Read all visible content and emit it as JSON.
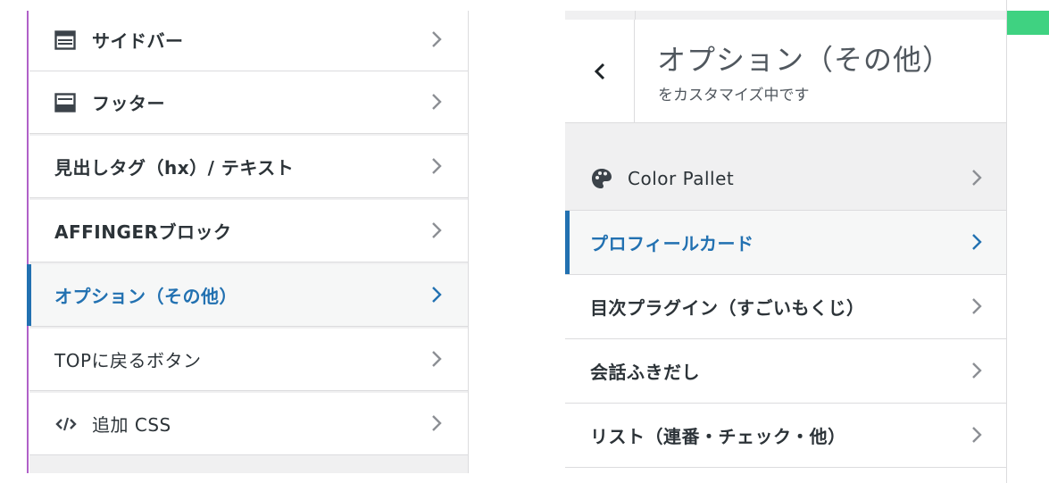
{
  "left_panel": {
    "items": [
      {
        "label": "サイドバー",
        "icon": "layout-icon"
      },
      {
        "label": "フッター",
        "icon": "layout-icon"
      },
      {
        "label": "見出しタグ（hx）/ テキスト"
      },
      {
        "label": "AFFINGERブロック"
      },
      {
        "label": "オプション（その他）",
        "active": true
      },
      {
        "label": "TOPに戻るボタン"
      },
      {
        "label": "追加 CSS",
        "icon": "code-icon"
      }
    ]
  },
  "right_panel": {
    "title": "オプション（その他）",
    "subtitle": "をカスタマイズ中です",
    "items": [
      {
        "label": "Color Pallet",
        "icon": "palette-icon"
      },
      {
        "label": "プロフィールカード",
        "active": true
      },
      {
        "label": "目次プラグイン（すごいもくじ）"
      },
      {
        "label": "会話ふきだし"
      },
      {
        "label": "リスト（連番・チェック・他）"
      }
    ]
  },
  "colors": {
    "accent": "#2271b1",
    "left_edge": "#b061c8",
    "green_tab": "#3fd281"
  }
}
